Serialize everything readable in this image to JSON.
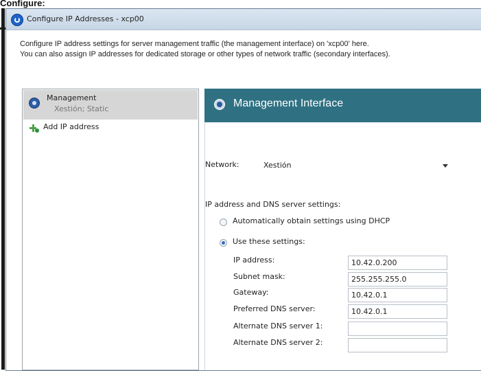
{
  "page": {
    "caption": "Configure:"
  },
  "window": {
    "title": "Configure IP Addresses - xcp00",
    "intro_line1": "Configure IP address settings for server management traffic (the management interface) on 'xcp00' here.",
    "intro_line2": "You can also assign IP addresses for dedicated storage or other types of network traffic (secondary interfaces)."
  },
  "left_panel": {
    "selected_title": "Management",
    "selected_sub": "Xestión; Static",
    "add_label": "Add IP address"
  },
  "right_panel": {
    "header": "Management Interface",
    "network_label": "Network:",
    "network_value": "Xestión",
    "section_label": "IP address and DNS server settings:",
    "radio_auto": "Automatically obtain settings using DHCP",
    "radio_use": "Use these settings:",
    "fields": [
      {
        "label": "IP address:",
        "value": "10.42.0.200"
      },
      {
        "label": "Subnet mask:",
        "value": "255.255.255.0"
      },
      {
        "label": "Gateway:",
        "value": "10.42.0.1"
      },
      {
        "label": "Preferred DNS server:",
        "value": "10.42.0.1"
      },
      {
        "label": "Alternate DNS server 1:",
        "value": ""
      },
      {
        "label": "Alternate DNS server 2:",
        "value": ""
      }
    ]
  },
  "colors": {
    "header_bg": "#2f7182",
    "selected_bg": "#d6d6d6",
    "titlebar": "#c7d6e6",
    "radio_selected": "#2f6fc4",
    "add_icon": "#4ca24a"
  },
  "icons": {
    "title": "xenserver-icon",
    "management": "management-interface-icon",
    "add": "add-ip-icon",
    "header": "interface-icon",
    "select": "chevron-down-icon"
  }
}
